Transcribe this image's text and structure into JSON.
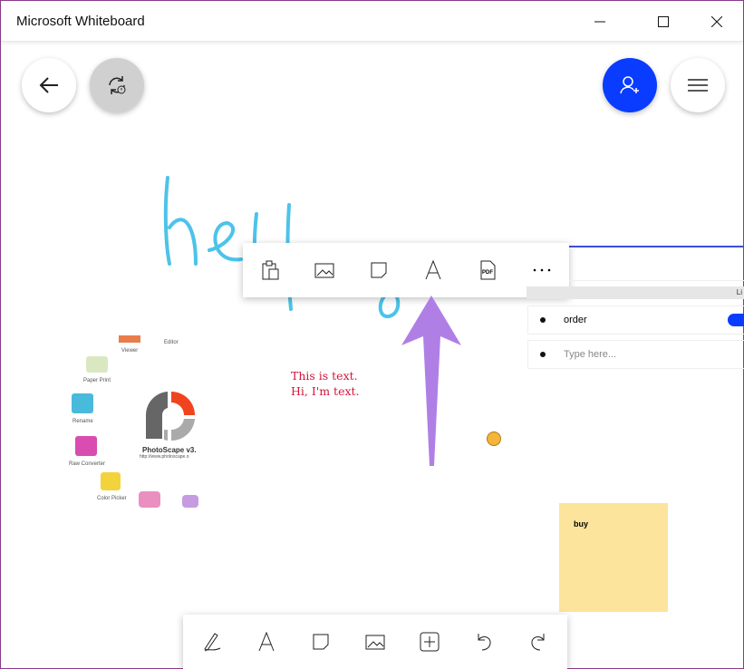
{
  "window": {
    "title": "Microsoft Whiteboard"
  },
  "canvas": {
    "handwriting": "hello",
    "red_text": [
      "This is text.",
      "Hi, I'm text."
    ],
    "list": {
      "header": "Li",
      "items": [
        {
          "text": "order"
        }
      ],
      "placeholder": "Type here..."
    },
    "sticky_note": {
      "text": "buy",
      "color": "#fde49c"
    },
    "photoscape": {
      "title": "PhotoScape v3.",
      "url": "http://www.photoscape.o",
      "labels": [
        "Editor",
        "Viewer",
        "Paper Print",
        "Rename",
        "Raw Converter",
        "Color Picker"
      ]
    }
  },
  "colors": {
    "accent": "#0a3cff",
    "ink_blue": "#4cc3ea",
    "ink_red": "#d4143a",
    "arrow": "#b07fe6"
  }
}
